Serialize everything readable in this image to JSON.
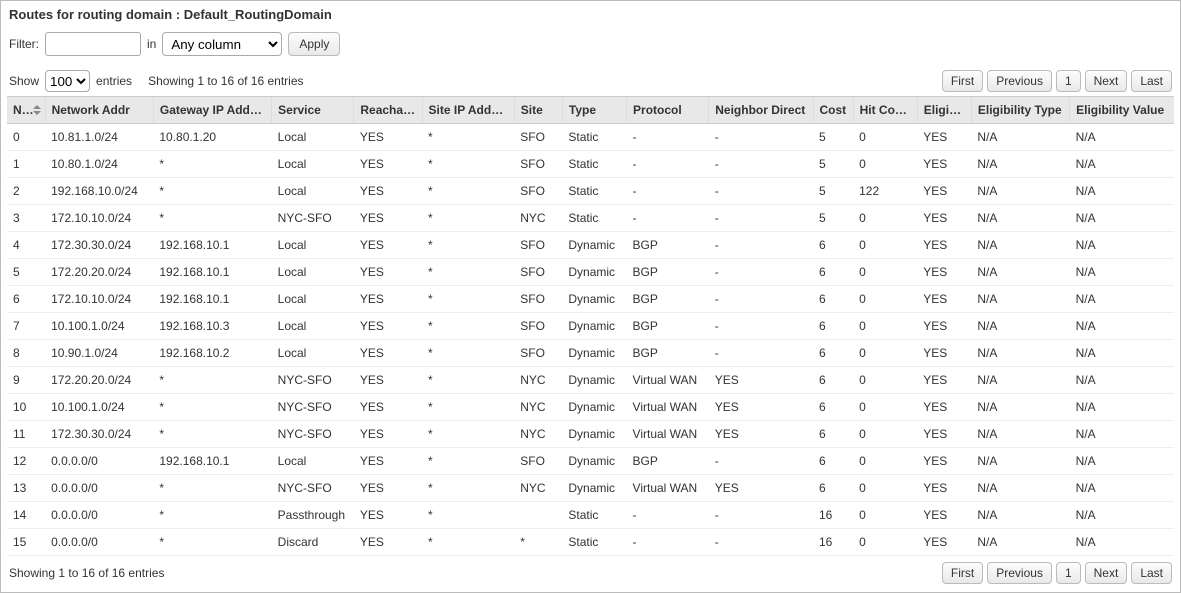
{
  "header": {
    "title_prefix": "Routes for routing domain : ",
    "routing_domain": "Default_RoutingDomain"
  },
  "filter": {
    "label": "Filter:",
    "value": "",
    "in_label": "in",
    "column_selected": "Any column",
    "apply_label": "Apply"
  },
  "table": {
    "show_label": "Show",
    "page_size": "100",
    "entries_label": "entries",
    "showing_text": "Showing 1 to 16 of 16 entries",
    "columns": [
      "Num",
      "Network Addr",
      "Gateway IP Address",
      "Service",
      "Reachable",
      "Site IP Address",
      "Site",
      "Type",
      "Protocol",
      "Neighbor Direct",
      "Cost",
      "Hit Count",
      "Eligible",
      "Eligibility Type",
      "Eligibility Value"
    ],
    "rows": [
      {
        "num": "0",
        "net": "10.81.1.0/24",
        "gw": "10.80.1.20",
        "svc": "Local",
        "reach": "YES",
        "sip": "*",
        "site": "SFO",
        "type": "Static",
        "proto": "-",
        "nd": "-",
        "cost": "5",
        "hit": "0",
        "elig": "YES",
        "etype": "N/A",
        "eval": "N/A"
      },
      {
        "num": "1",
        "net": "10.80.1.0/24",
        "gw": "*",
        "svc": "Local",
        "reach": "YES",
        "sip": "*",
        "site": "SFO",
        "type": "Static",
        "proto": "-",
        "nd": "-",
        "cost": "5",
        "hit": "0",
        "elig": "YES",
        "etype": "N/A",
        "eval": "N/A"
      },
      {
        "num": "2",
        "net": "192.168.10.0/24",
        "gw": "*",
        "svc": "Local",
        "reach": "YES",
        "sip": "*",
        "site": "SFO",
        "type": "Static",
        "proto": "-",
        "nd": "-",
        "cost": "5",
        "hit": "122",
        "elig": "YES",
        "etype": "N/A",
        "eval": "N/A"
      },
      {
        "num": "3",
        "net": "172.10.10.0/24",
        "gw": "*",
        "svc": "NYC-SFO",
        "reach": "YES",
        "sip": "*",
        "site": "NYC",
        "type": "Static",
        "proto": "-",
        "nd": "-",
        "cost": "5",
        "hit": "0",
        "elig": "YES",
        "etype": "N/A",
        "eval": "N/A"
      },
      {
        "num": "4",
        "net": "172.30.30.0/24",
        "gw": "192.168.10.1",
        "svc": "Local",
        "reach": "YES",
        "sip": "*",
        "site": "SFO",
        "type": "Dynamic",
        "proto": "BGP",
        "nd": "-",
        "cost": "6",
        "hit": "0",
        "elig": "YES",
        "etype": "N/A",
        "eval": "N/A"
      },
      {
        "num": "5",
        "net": "172.20.20.0/24",
        "gw": "192.168.10.1",
        "svc": "Local",
        "reach": "YES",
        "sip": "*",
        "site": "SFO",
        "type": "Dynamic",
        "proto": "BGP",
        "nd": "-",
        "cost": "6",
        "hit": "0",
        "elig": "YES",
        "etype": "N/A",
        "eval": "N/A"
      },
      {
        "num": "6",
        "net": "172.10.10.0/24",
        "gw": "192.168.10.1",
        "svc": "Local",
        "reach": "YES",
        "sip": "*",
        "site": "SFO",
        "type": "Dynamic",
        "proto": "BGP",
        "nd": "-",
        "cost": "6",
        "hit": "0",
        "elig": "YES",
        "etype": "N/A",
        "eval": "N/A"
      },
      {
        "num": "7",
        "net": "10.100.1.0/24",
        "gw": "192.168.10.3",
        "svc": "Local",
        "reach": "YES",
        "sip": "*",
        "site": "SFO",
        "type": "Dynamic",
        "proto": "BGP",
        "nd": "-",
        "cost": "6",
        "hit": "0",
        "elig": "YES",
        "etype": "N/A",
        "eval": "N/A"
      },
      {
        "num": "8",
        "net": "10.90.1.0/24",
        "gw": "192.168.10.2",
        "svc": "Local",
        "reach": "YES",
        "sip": "*",
        "site": "SFO",
        "type": "Dynamic",
        "proto": "BGP",
        "nd": "-",
        "cost": "6",
        "hit": "0",
        "elig": "YES",
        "etype": "N/A",
        "eval": "N/A"
      },
      {
        "num": "9",
        "net": "172.20.20.0/24",
        "gw": "*",
        "svc": "NYC-SFO",
        "reach": "YES",
        "sip": "*",
        "site": "NYC",
        "type": "Dynamic",
        "proto": "Virtual WAN",
        "nd": "YES",
        "cost": "6",
        "hit": "0",
        "elig": "YES",
        "etype": "N/A",
        "eval": "N/A"
      },
      {
        "num": "10",
        "net": "10.100.1.0/24",
        "gw": "*",
        "svc": "NYC-SFO",
        "reach": "YES",
        "sip": "*",
        "site": "NYC",
        "type": "Dynamic",
        "proto": "Virtual WAN",
        "nd": "YES",
        "cost": "6",
        "hit": "0",
        "elig": "YES",
        "etype": "N/A",
        "eval": "N/A"
      },
      {
        "num": "11",
        "net": "172.30.30.0/24",
        "gw": "*",
        "svc": "NYC-SFO",
        "reach": "YES",
        "sip": "*",
        "site": "NYC",
        "type": "Dynamic",
        "proto": "Virtual WAN",
        "nd": "YES",
        "cost": "6",
        "hit": "0",
        "elig": "YES",
        "etype": "N/A",
        "eval": "N/A"
      },
      {
        "num": "12",
        "net": "0.0.0.0/0",
        "gw": "192.168.10.1",
        "svc": "Local",
        "reach": "YES",
        "sip": "*",
        "site": "SFO",
        "type": "Dynamic",
        "proto": "BGP",
        "nd": "-",
        "cost": "6",
        "hit": "0",
        "elig": "YES",
        "etype": "N/A",
        "eval": "N/A"
      },
      {
        "num": "13",
        "net": "0.0.0.0/0",
        "gw": "*",
        "svc": "NYC-SFO",
        "reach": "YES",
        "sip": "*",
        "site": "NYC",
        "type": "Dynamic",
        "proto": "Virtual WAN",
        "nd": "YES",
        "cost": "6",
        "hit": "0",
        "elig": "YES",
        "etype": "N/A",
        "eval": "N/A"
      },
      {
        "num": "14",
        "net": "0.0.0.0/0",
        "gw": "*",
        "svc": "Passthrough",
        "reach": "YES",
        "sip": "*",
        "site": "",
        "type": "Static",
        "proto": "-",
        "nd": "-",
        "cost": "16",
        "hit": "0",
        "elig": "YES",
        "etype": "N/A",
        "eval": "N/A"
      },
      {
        "num": "15",
        "net": "0.0.0.0/0",
        "gw": "*",
        "svc": "Discard",
        "reach": "YES",
        "sip": "*",
        "site": "*",
        "type": "Static",
        "proto": "-",
        "nd": "-",
        "cost": "16",
        "hit": "0",
        "elig": "YES",
        "etype": "N/A",
        "eval": "N/A"
      }
    ]
  },
  "pager": {
    "first": "First",
    "prev": "Previous",
    "page1": "1",
    "next": "Next",
    "last": "Last"
  }
}
